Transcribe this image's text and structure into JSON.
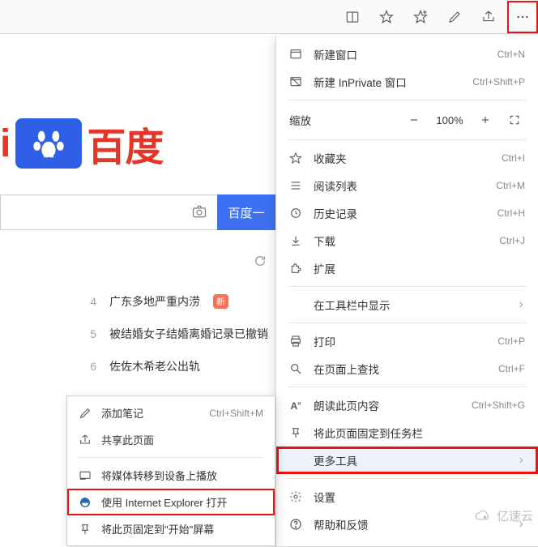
{
  "toolbar": {
    "icons": [
      "reading-view-icon",
      "favorite-icon",
      "add-favorites-icon",
      "note-icon",
      "share-icon",
      "more-icon"
    ]
  },
  "page": {
    "logo_du": "du",
    "logo_i": "i",
    "logo_text": "百度",
    "search_button": "百度一",
    "camera_aria": "image-search",
    "refresh_icon": "↻",
    "news": [
      {
        "rank": "4",
        "text": "广东多地严重内涝",
        "hot": "新"
      },
      {
        "rank": "5",
        "text": "被结婚女子结婚离婚记录已撤销",
        "hot": ""
      },
      {
        "rank": "6",
        "text": "佐佐木希老公出轨",
        "hot": ""
      }
    ]
  },
  "menu": {
    "new_window": {
      "label": "新建窗口",
      "shortcut": "Ctrl+N"
    },
    "new_private": {
      "label": "新建 InPrivate 窗口",
      "shortcut": "Ctrl+Shift+P"
    },
    "zoom": {
      "label": "缩放",
      "value": "100%"
    },
    "favorites": {
      "label": "收藏夹",
      "shortcut": "Ctrl+I"
    },
    "reading_list": {
      "label": "阅读列表",
      "shortcut": "Ctrl+M"
    },
    "history": {
      "label": "历史记录",
      "shortcut": "Ctrl+H"
    },
    "downloads": {
      "label": "下载",
      "shortcut": "Ctrl+J"
    },
    "extensions": {
      "label": "扩展"
    },
    "show_in_toolbar": {
      "label": "在工具栏中显示"
    },
    "print": {
      "label": "打印",
      "shortcut": "Ctrl+P"
    },
    "find": {
      "label": "在页面上查找",
      "shortcut": "Ctrl+F"
    },
    "read_aloud": {
      "label": "朗读此页内容",
      "shortcut": "Ctrl+Shift+G"
    },
    "pin_taskbar": {
      "label": "将此页面固定到任务栏"
    },
    "more_tools": {
      "label": "更多工具"
    },
    "settings": {
      "label": "设置"
    },
    "help": {
      "label": "帮助和反馈"
    }
  },
  "submenu": {
    "add_note": {
      "label": "添加笔记",
      "shortcut": "Ctrl+Shift+M"
    },
    "share_page": {
      "label": "共享此页面"
    },
    "cast": {
      "label": "将媒体转移到设备上播放"
    },
    "open_ie": {
      "label": "使用 Internet Explorer 打开"
    },
    "pin_start": {
      "label": "将此页固定到\"开始\"屏幕"
    }
  },
  "watermark": {
    "text": "亿速云"
  }
}
